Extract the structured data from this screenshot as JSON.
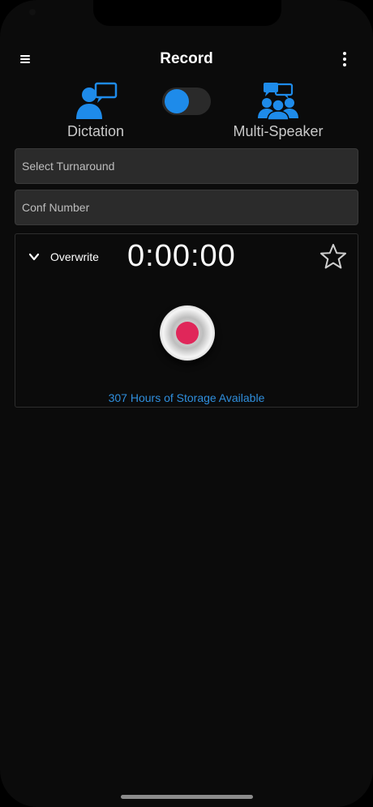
{
  "header": {
    "title": "Record"
  },
  "mode": {
    "dictation_label": "Dictation",
    "multi_speaker_label": "Multi-Speaker",
    "toggle_state": "dictation"
  },
  "fields": {
    "turnaround_placeholder": "Select Turnaround",
    "conf_placeholder": "Conf Number"
  },
  "recorder": {
    "overwrite_label": "Overwrite",
    "timer": "0:00:00",
    "storage_text": "307 Hours of Storage Available"
  },
  "icons": {
    "menu": "hamburger-menu-icon",
    "more": "kebab-menu-icon",
    "dictation": "single-speaker-icon",
    "multi_speaker": "multi-speaker-icon",
    "chevron": "chevron-down-icon",
    "favorite": "star-icon",
    "record": "record-icon"
  },
  "colors": {
    "accent": "#1e8bea",
    "record": "#e0275a",
    "link": "#2f8fdd",
    "background": "#0b0b0b",
    "field": "#2b2b2b"
  }
}
